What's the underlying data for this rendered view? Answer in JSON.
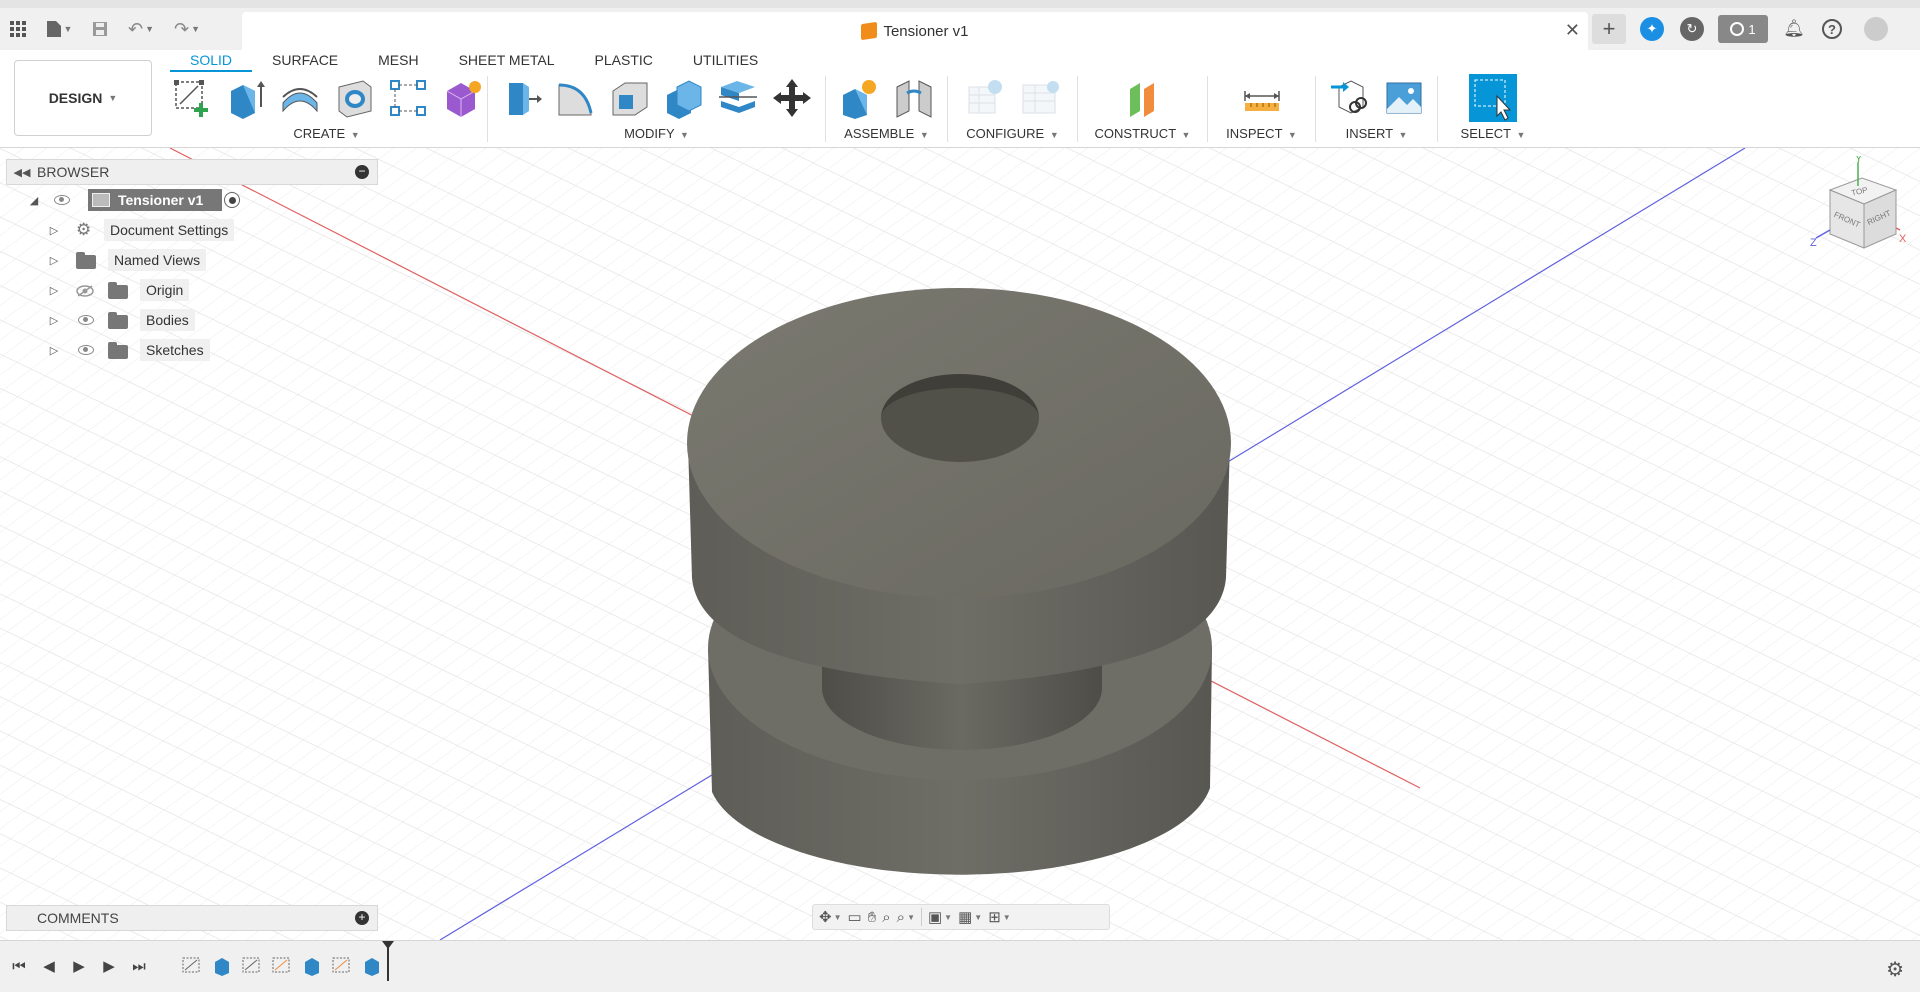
{
  "titlebar": {
    "document_title": "Tensioner v1",
    "close_glyph": "✕",
    "job_count": "1",
    "icons": [
      "apps-grid-icon",
      "file-icon",
      "save-icon",
      "undo-icon",
      "redo-icon",
      "new-tab-icon",
      "extensions-icon",
      "online-status-icon",
      "job-status-icon",
      "notifications-icon",
      "help-icon",
      "profile-icon"
    ]
  },
  "ribbon": {
    "workspace": "DESIGN",
    "tabs": [
      "SOLID",
      "SURFACE",
      "MESH",
      "SHEET METAL",
      "PLASTIC",
      "UTILITIES"
    ],
    "active_tab": "SOLID",
    "groups": {
      "create": "CREATE",
      "modify": "MODIFY",
      "assemble": "ASSEMBLE",
      "configure": "CONFIGURE",
      "construct": "CONSTRUCT",
      "inspect": "INSPECT",
      "insert": "INSERT",
      "select": "SELECT"
    }
  },
  "browser": {
    "title": "BROWSER",
    "root": "Tensioner v1",
    "items": [
      {
        "label": "Document Settings",
        "icon": "gear-icon"
      },
      {
        "label": "Named Views",
        "icon": "folder-icon"
      },
      {
        "label": "Origin",
        "icon": "folder-icon",
        "visibility": "hidden"
      },
      {
        "label": "Bodies",
        "icon": "folder-icon",
        "visibility": "visible"
      },
      {
        "label": "Sketches",
        "icon": "folder-icon",
        "visibility": "visible"
      }
    ]
  },
  "comments": {
    "title": "COMMENTS"
  },
  "viewcube": {
    "top": "TOP",
    "front": "FRONT",
    "right": "RIGHT",
    "axis_x": "X",
    "axis_y": "Y",
    "axis_z": "Z"
  },
  "colors": {
    "accent": "#0696d7",
    "model": "#6f6e66",
    "axis_red": "#e06060",
    "axis_blue": "#6060e0"
  }
}
